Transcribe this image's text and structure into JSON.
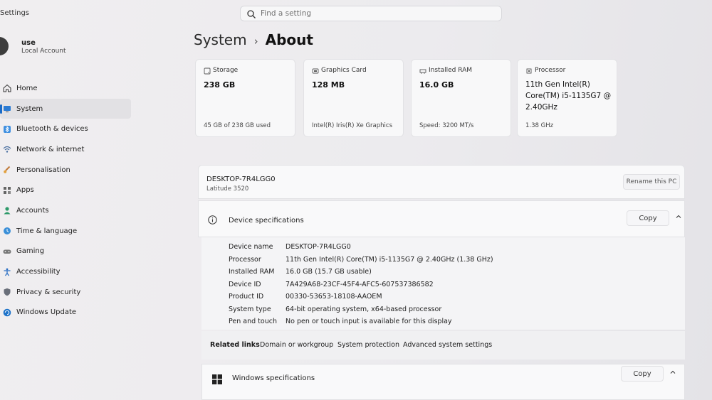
{
  "app": {
    "title": "Settings"
  },
  "search": {
    "placeholder": "Find a setting",
    "value": ""
  },
  "user": {
    "name": "use",
    "account_type": "Local Account"
  },
  "sidebar": {
    "items": [
      {
        "label": "Home",
        "icon": "home-icon"
      },
      {
        "label": "System",
        "icon": "monitor-icon",
        "active": true
      },
      {
        "label": "Bluetooth & devices",
        "icon": "bluetooth-icon"
      },
      {
        "label": "Network & internet",
        "icon": "wifi-icon"
      },
      {
        "label": "Personalisation",
        "icon": "brush-icon"
      },
      {
        "label": "Apps",
        "icon": "apps-icon"
      },
      {
        "label": "Accounts",
        "icon": "person-icon"
      },
      {
        "label": "Time & language",
        "icon": "globe-clock-icon"
      },
      {
        "label": "Gaming",
        "icon": "gamepad-icon"
      },
      {
        "label": "Accessibility",
        "icon": "accessibility-icon"
      },
      {
        "label": "Privacy & security",
        "icon": "shield-icon"
      },
      {
        "label": "Windows Update",
        "icon": "update-icon"
      }
    ]
  },
  "breadcrumb": {
    "parent": "System",
    "separator": "›",
    "current": "About"
  },
  "cards": [
    {
      "label": "Storage",
      "value": "238 GB",
      "sub": "45 GB of 238 GB used",
      "icon": "storage-icon"
    },
    {
      "label": "Graphics Card",
      "value": "128 MB",
      "sub": "Intel(R) Iris(R) Xe Graphics",
      "icon": "gpu-icon"
    },
    {
      "label": "Installed RAM",
      "value": "16.0 GB",
      "sub": "Speed: 3200 MT/s",
      "icon": "ram-icon"
    },
    {
      "label": "Processor",
      "value": "11th Gen Intel(R) Core(TM) i5-1135G7 @ 2.40GHz",
      "sub": "1.38 GHz",
      "icon": "cpu-icon"
    }
  ],
  "device": {
    "name": "DESKTOP-7R4LGG0",
    "model": "Latitude 3520",
    "rename_label": "Rename this PC"
  },
  "device_specs": {
    "title": "Device specifications",
    "copy_label": "Copy",
    "rows": [
      {
        "key": "Device name",
        "value": "DESKTOP-7R4LGG0"
      },
      {
        "key": "Processor",
        "value": "11th Gen Intel(R) Core(TM) i5-1135G7 @ 2.40GHz (1.38 GHz)"
      },
      {
        "key": "Installed RAM",
        "value": "16.0 GB (15.7 GB usable)"
      },
      {
        "key": "Device ID",
        "value": "7A429A68-23CF-45F4-AFC5-607537386582"
      },
      {
        "key": "Product ID",
        "value": "00330-53653-18108-AAOEM"
      },
      {
        "key": "System type",
        "value": "64-bit operating system, x64-based processor"
      },
      {
        "key": "Pen and touch",
        "value": "No pen or touch input is available for this display"
      }
    ]
  },
  "related_links": {
    "label": "Related links",
    "links": [
      "Domain or workgroup",
      "System protection",
      "Advanced system settings"
    ]
  },
  "windows_specs": {
    "title": "Windows specifications",
    "copy_label": "Copy"
  }
}
